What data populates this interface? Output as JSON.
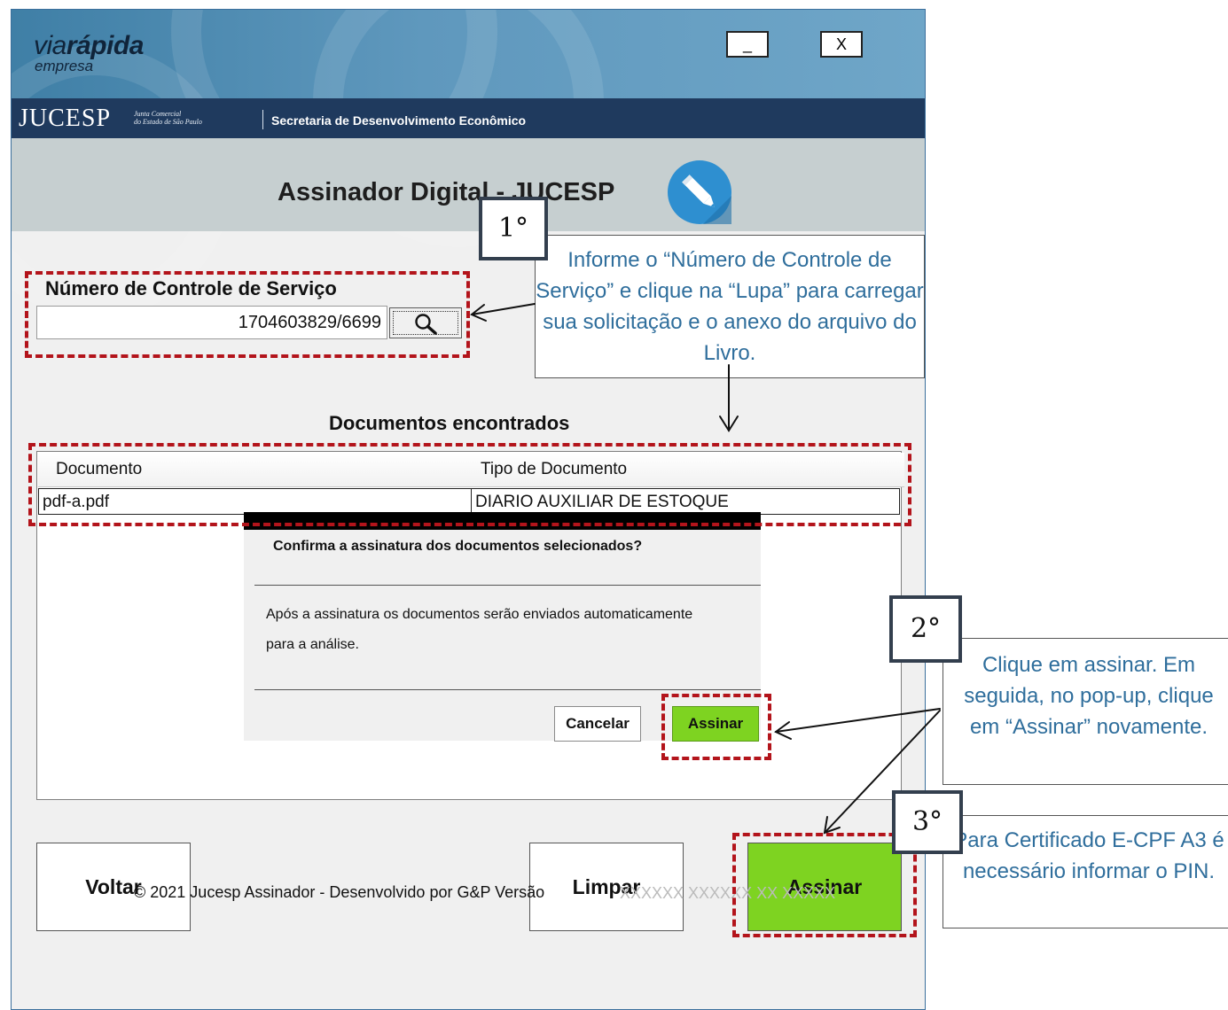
{
  "window": {
    "brand_main": "via",
    "brand_bold": "rápida",
    "brand_sub": "empresa",
    "minimize_label": "_",
    "close_label": "X"
  },
  "band": {
    "org": "JUCESP",
    "org_small_1": "Junta Comercial",
    "org_small_2": "do Estado de São Paulo",
    "secretaria": "Secretaria de Desenvolvimento Econômico"
  },
  "title": "Assinador Digital - JUCESP",
  "service": {
    "label": "Número de Controle de Serviço",
    "value": "1704603829/6699"
  },
  "documents": {
    "heading": "Documentos encontrados",
    "columns": [
      "Documento",
      "Tipo de Documento"
    ],
    "rows": [
      {
        "documento": "pdf-a.pdf",
        "tipo": "DIARIO AUXILIAR DE ESTOQUE"
      }
    ]
  },
  "dialog": {
    "question": "Confirma a assinatura dos documentos selecionados?",
    "message_line1": "Após a assinatura os documentos serão enviados automaticamente",
    "message_line2": "para a análise.",
    "cancel_label": "Cancelar",
    "confirm_label": "Assinar"
  },
  "buttons": {
    "back": "Voltar",
    "clear": "Limpar",
    "sign": "Assinar"
  },
  "footer": {
    "text": "© 2021 Jucesp Assinador - Desenvolvido por G&P Versão",
    "version": "XXXXXX XXXXXX XX XXXXX"
  },
  "annotations": {
    "step1": {
      "badge": "1°",
      "text": "Informe o “Número de Controle de Serviço” e clique na “Lupa” para carregar sua solicitação e o anexo do arquivo do Livro."
    },
    "step2": {
      "badge": "2°",
      "text": "Clique em assinar. Em seguida, no pop-up, clique em “Assinar” novamente."
    },
    "step3": {
      "badge": "3°",
      "text": "Para Certificado E-CPF A3 é necessário informar o PIN."
    }
  },
  "colors": {
    "header_blue": "#5f98bd",
    "band_navy": "#1f3a5e",
    "sign_green": "#7ed321",
    "annotation_red": "#b3141b",
    "callout_text": "#2f6e9c"
  }
}
